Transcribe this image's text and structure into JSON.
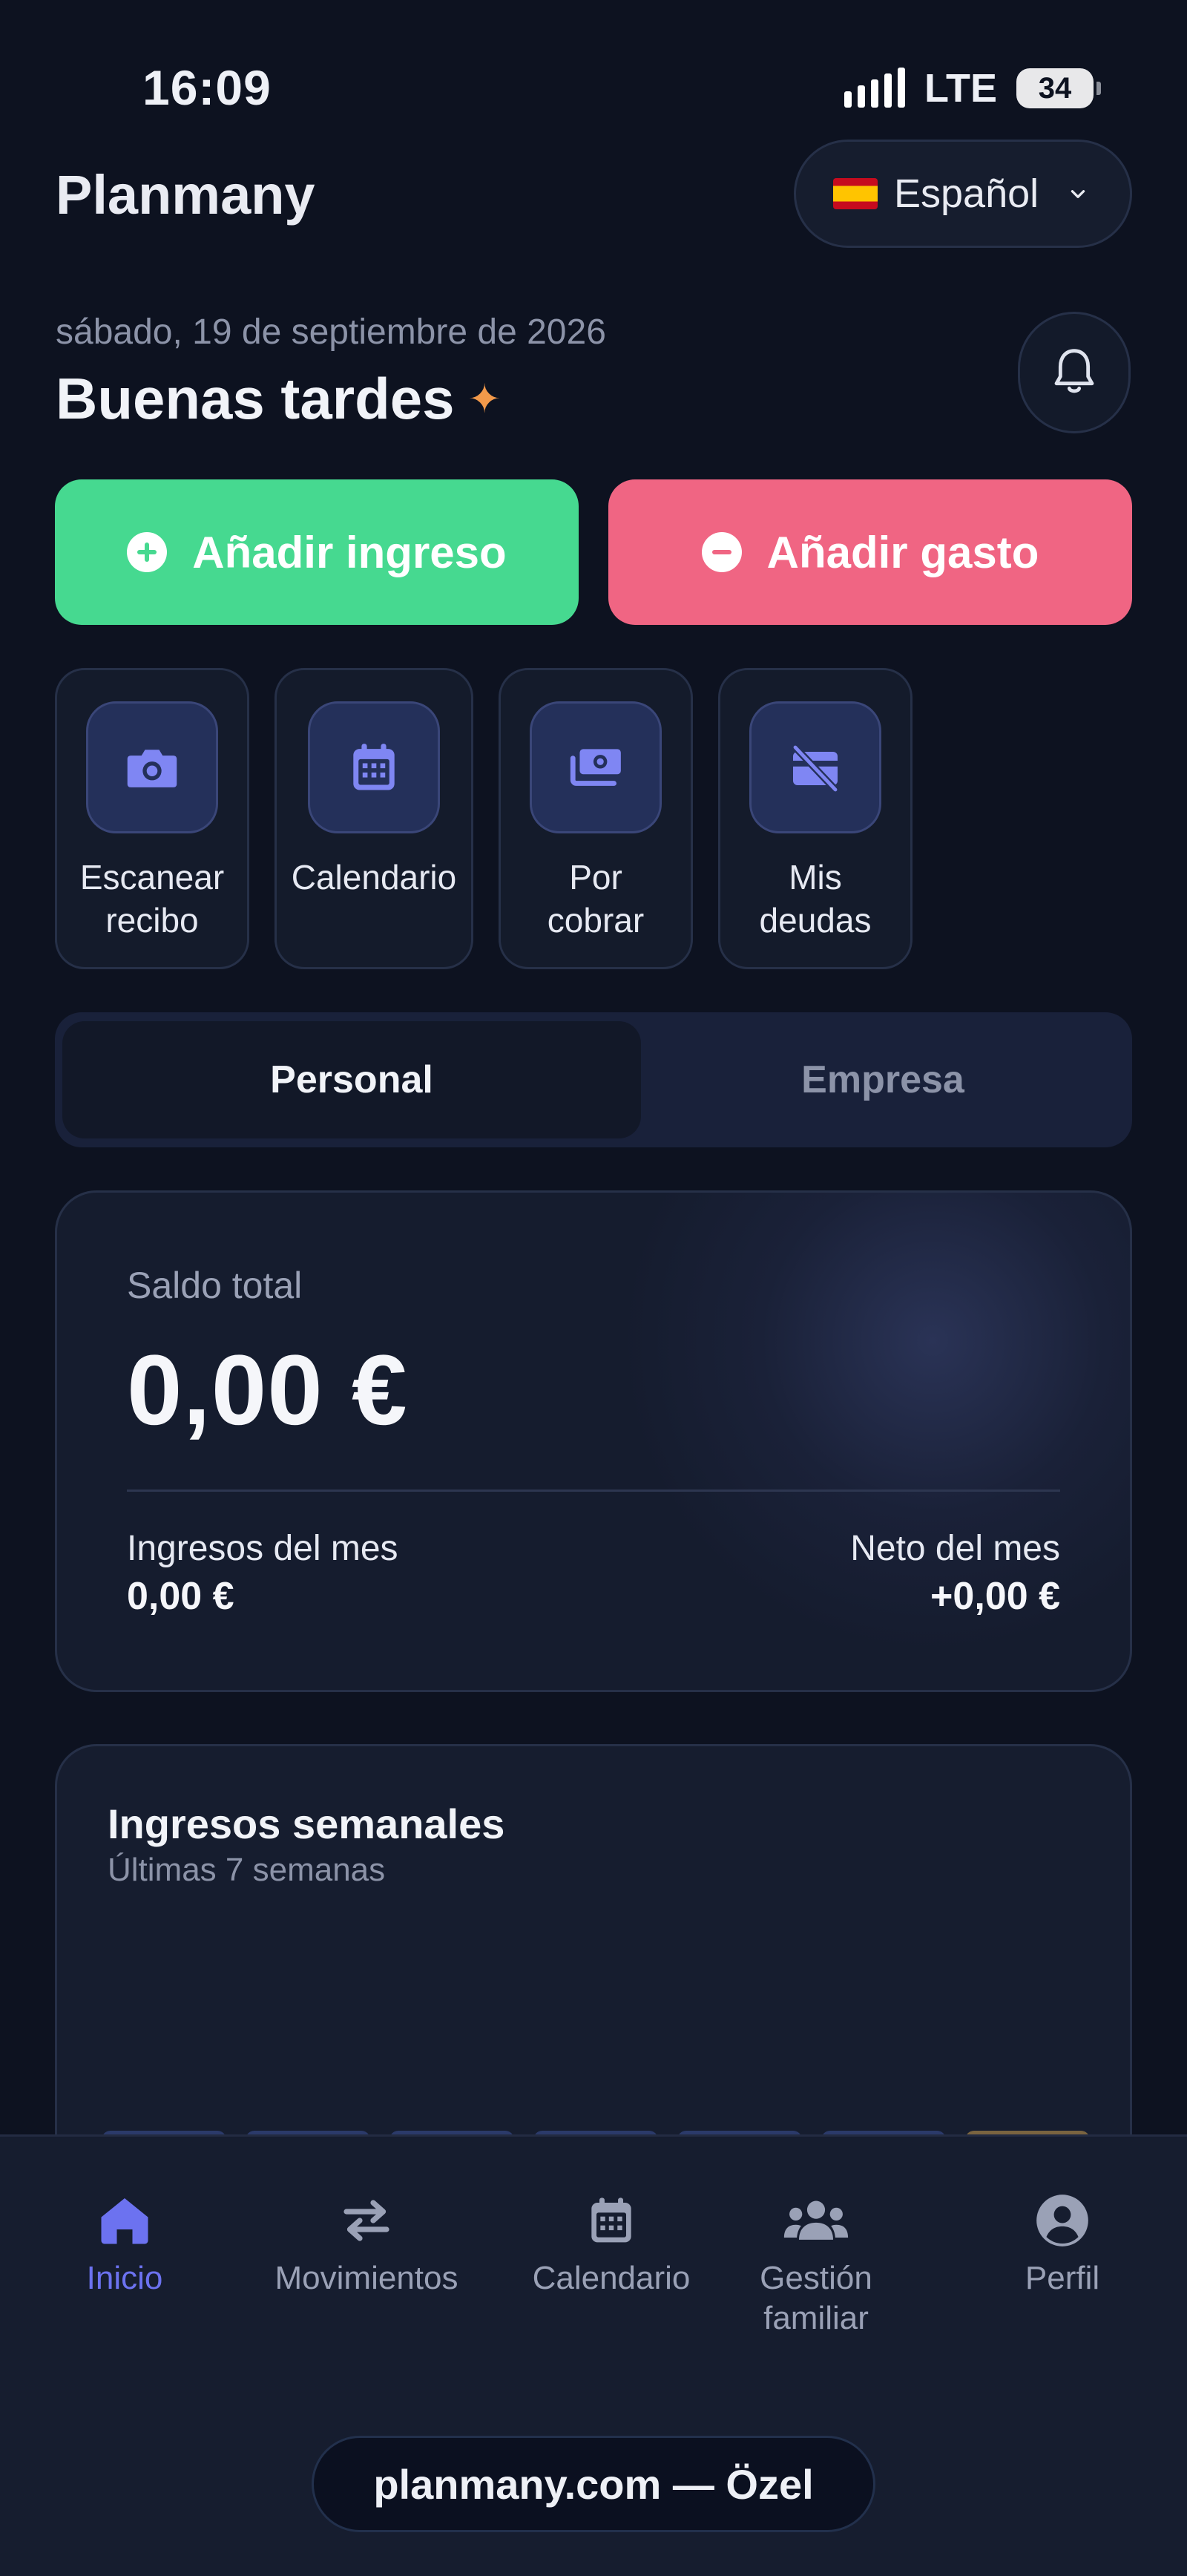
{
  "status_bar": {
    "time": "16:09",
    "network": "LTE",
    "battery": "34"
  },
  "header": {
    "app_name": "Planmany",
    "language": {
      "label": "Español",
      "flag_icon": "spain-flag-icon"
    }
  },
  "greeting": {
    "date": "sábado, 19 de septiembre de 2026",
    "text": "Buenas tardes",
    "sparkle": "✦"
  },
  "actions": {
    "add_income": {
      "label": "Añadir ingreso",
      "color": "#46d990",
      "icon": "plus-circle-icon"
    },
    "add_expense": {
      "label": "Añadir gasto",
      "color": "#f06583",
      "icon": "minus-circle-icon"
    }
  },
  "quick_actions": [
    {
      "line1": "Escanear",
      "line2": "recibo",
      "icon": "camera-icon"
    },
    {
      "line1": "Calendario",
      "line2": "",
      "icon": "calendar-icon"
    },
    {
      "line1": "Por",
      "line2": "cobrar",
      "icon": "money-icon"
    },
    {
      "line1": "Mis",
      "line2": "deudas",
      "icon": "card-off-icon"
    }
  ],
  "segments": {
    "active": "Personal",
    "inactive": "Empresa"
  },
  "balance": {
    "label": "Saldo total",
    "amount": "0,00 €",
    "income_label": "Ingresos del mes",
    "income_value": "0,00 €",
    "net_label": "Neto del mes",
    "net_value": "+0,00 €"
  },
  "weekly": {
    "title": "Ingresos semanales",
    "subtitle": "Últimas 7 semanas",
    "bar_colors": [
      "#2b3a6a",
      "#2b3a6a",
      "#2b3a6a",
      "#2b3a6a",
      "#2b3a6a",
      "#2b3a6a",
      "#7a6440"
    ]
  },
  "nav": [
    {
      "label": "Inicio",
      "icon": "home-icon",
      "active": true
    },
    {
      "label": "Movimientos",
      "icon": "arrows-icon",
      "active": false
    },
    {
      "label": "Calendario",
      "icon": "calendar-icon",
      "active": false
    },
    {
      "label": "Gestión familiar",
      "icon": "people-icon",
      "active": false
    },
    {
      "label": "Perfil",
      "icon": "user-circle-icon",
      "active": false
    }
  ],
  "url": "planmany.com — Özel",
  "colors": {
    "background": "#0d1220",
    "accent": "#6c72f0",
    "card": "#161d2f"
  }
}
